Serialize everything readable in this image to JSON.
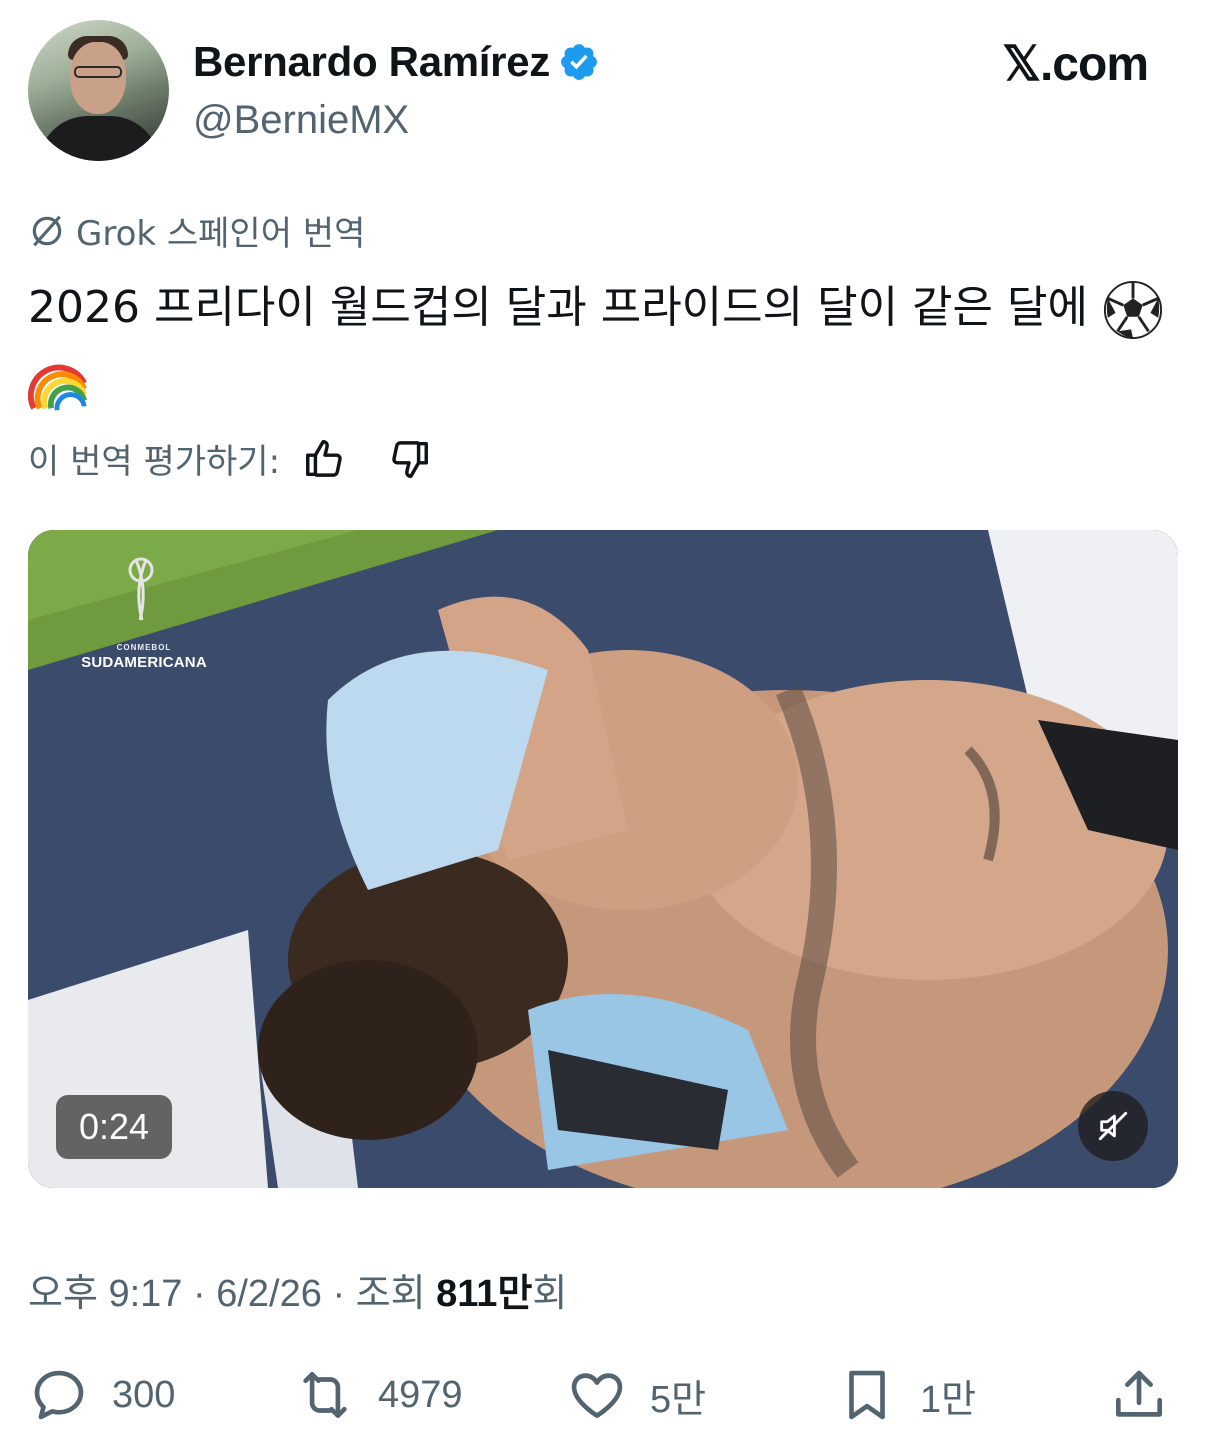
{
  "author": {
    "name": "Bernardo Ramírez",
    "handle": "@BernieMX",
    "verified": true,
    "verified_color": "#1d9bf0"
  },
  "brand": "𝕏.com",
  "translation": {
    "label": "Grok 스페인어 번역",
    "icon": "grok-icon"
  },
  "tweet": {
    "text": "2026 프리다이 월드컵의 달과 프라이드의 달이 같은 달에",
    "emojis": [
      "soccer-ball-emoji",
      "rainbow-emoji"
    ]
  },
  "rating": {
    "label": "이 번역 평가하기:",
    "up_icon": "thumbs-up-icon",
    "down_icon": "thumbs-down-icon"
  },
  "media": {
    "overlay_league_small": "CONMEBOL",
    "overlay_league": "SUDAMERICANA",
    "duration": "0:24",
    "mute_icon": "muted-speaker-icon"
  },
  "meta": {
    "time": "오후 9:17",
    "date": "6/2/26",
    "views_prefix": "조회",
    "views": "811만",
    "views_suffix": "회",
    "separator": "·"
  },
  "actions": {
    "replies": "300",
    "reposts": "4979",
    "likes": "5만",
    "bookmarks": "1만"
  },
  "colors": {
    "text": "#0f1419",
    "secondary": "#536471",
    "accent": "#1d9bf0"
  }
}
